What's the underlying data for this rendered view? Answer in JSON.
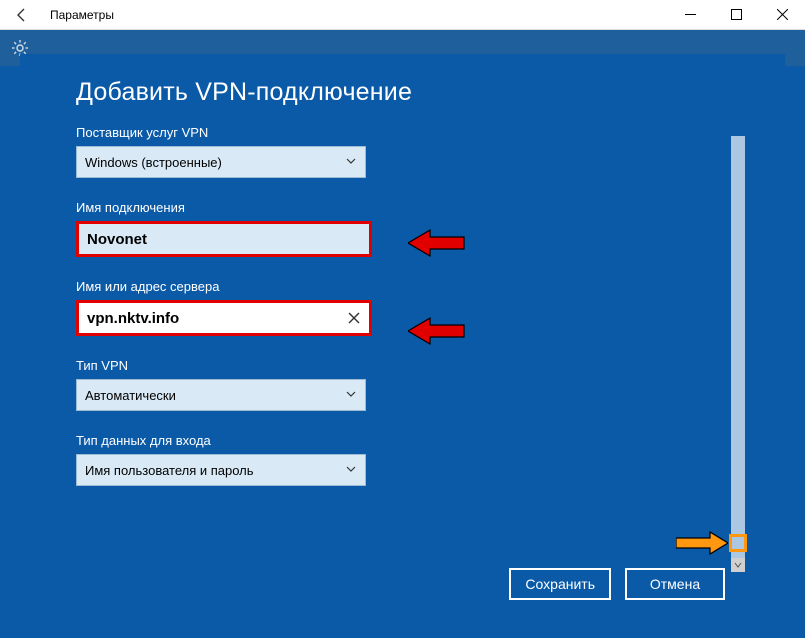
{
  "window": {
    "title": "Параметры"
  },
  "subheader": {
    "label": ""
  },
  "dialog": {
    "heading": "Добавить VPN-подключение",
    "provider": {
      "label": "Поставщик услуг VPN",
      "value": "Windows (встроенные)"
    },
    "connection_name": {
      "label": "Имя подключения",
      "value": "Novonet"
    },
    "server": {
      "label": "Имя или адрес сервера",
      "value": "vpn.nktv.info"
    },
    "vpn_type": {
      "label": "Тип VPN",
      "value": "Автоматически"
    },
    "signin_type": {
      "label": "Тип данных для входа",
      "value": "Имя пользователя и пароль"
    },
    "buttons": {
      "save": "Сохранить",
      "cancel": "Отмена"
    }
  }
}
